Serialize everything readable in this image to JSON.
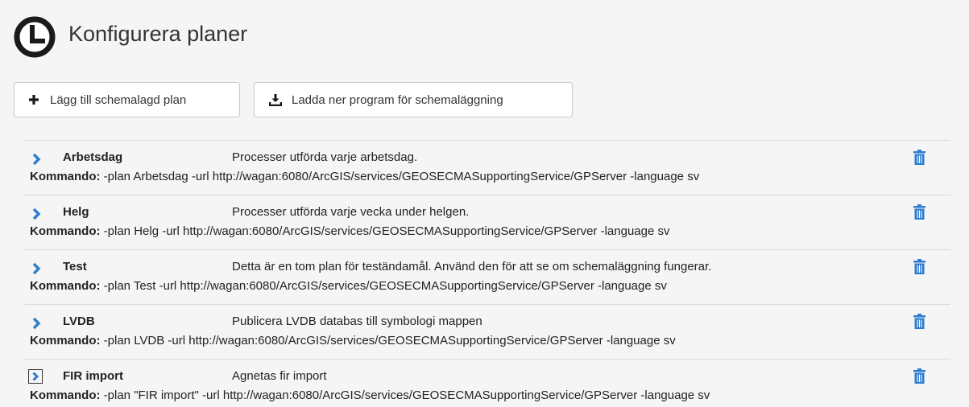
{
  "header": {
    "title": "Konfigurera planer",
    "icon": "clock-icon"
  },
  "toolbar": {
    "add_label": "Lägg till schemalagd plan",
    "download_label": "Ladda ner program för schemaläggning"
  },
  "command_label": "Kommando:",
  "colors": {
    "accent": "#2e7bcf",
    "icon_dark": "#1a1a1a"
  },
  "plans": [
    {
      "name": "Arbetsdag",
      "description": "Processer utförda varje arbetsdag.",
      "command": "-plan Arbetsdag -url http://wagan:6080/ArcGIS/services/GEOSECMASupportingService/GPServer -language sv"
    },
    {
      "name": "Helg",
      "description": "Processer utförda varje vecka under helgen.",
      "command": "-plan Helg -url http://wagan:6080/ArcGIS/services/GEOSECMASupportingService/GPServer -language sv"
    },
    {
      "name": "Test",
      "description": "Detta är en tom plan för teständamål. Använd den för att se om schemaläggning fungerar.",
      "command": "-plan Test -url http://wagan:6080/ArcGIS/services/GEOSECMASupportingService/GPServer -language sv"
    },
    {
      "name": "LVDB",
      "description": "Publicera LVDB databas till symbologi mappen",
      "command": "-plan LVDB -url http://wagan:6080/ArcGIS/services/GEOSECMASupportingService/GPServer -language sv"
    },
    {
      "name": "FIR import",
      "description": "Agnetas fir import",
      "command": "-plan \"FIR import\" -url http://wagan:6080/ArcGIS/services/GEOSECMASupportingService/GPServer -language sv"
    }
  ]
}
